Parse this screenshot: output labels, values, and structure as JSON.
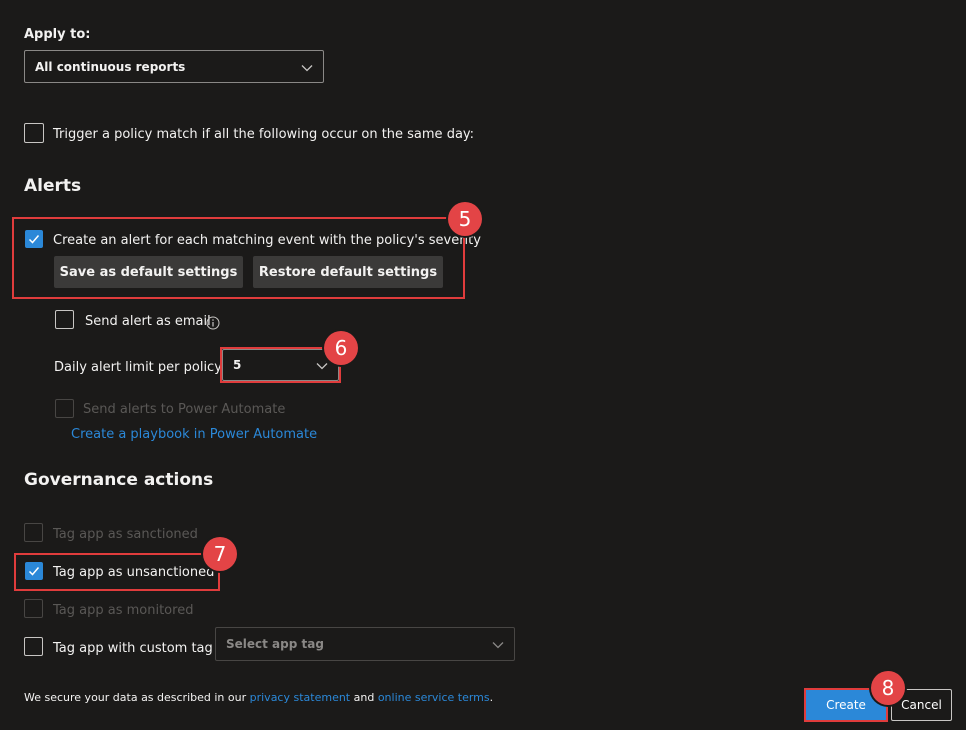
{
  "apply_to": {
    "label": "Apply to:",
    "selected": "All continuous reports"
  },
  "trigger": {
    "label": "Trigger a policy match if all the following occur on the same day:",
    "checked": false
  },
  "alerts": {
    "heading": "Alerts",
    "create_alert_label": "Create an alert for each matching event with the policy's severity",
    "save_default_label": "Save as default settings",
    "restore_default_label": "Restore default settings",
    "send_email_label": "Send alert as email",
    "daily_limit_label": "Daily alert limit per policy",
    "daily_limit_value": "5",
    "power_automate_label": "Send alerts to Power Automate",
    "playbook_link": "Create a playbook in Power Automate"
  },
  "governance": {
    "heading": "Governance actions",
    "sanctioned_label": "Tag app as sanctioned",
    "unsanctioned_label": "Tag app as unsanctioned",
    "monitored_label": "Tag app as monitored",
    "custom_tag_label": "Tag app with custom tag",
    "custom_tag_placeholder": "Select app tag"
  },
  "footer": {
    "privacy_prefix": "We secure your data as described in our",
    "privacy_link": "privacy statement",
    "and": "and",
    "terms_link": "online service terms",
    "period": ".",
    "create_label": "Create",
    "cancel_label": "Cancel"
  },
  "badges": {
    "b5": "5",
    "b6": "6",
    "b7": "7",
    "b8": "8"
  },
  "colors": {
    "background": "#1b1a19",
    "accent": "#2b88d8",
    "highlight": "#e03c3c",
    "badge": "#e34446"
  }
}
